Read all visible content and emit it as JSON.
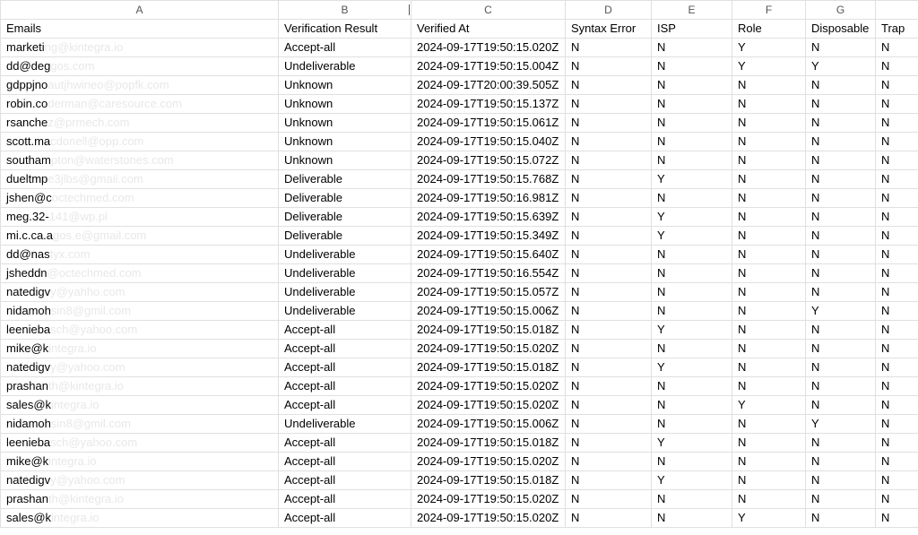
{
  "columns": [
    "A",
    "B",
    "C",
    "D",
    "E",
    "F",
    "G",
    ""
  ],
  "headers": {
    "a": "Emails",
    "b": "Verification Result",
    "c": "Verified At",
    "d": "Syntax Error",
    "e": "ISP",
    "f": "Role",
    "g": "Disposable",
    "h": "Trap"
  },
  "rows": [
    {
      "email_vis": "marketi",
      "email_rest": "ng@kintegra.io",
      "result": "Accept-all",
      "verified": "2024-09-17T19:50:15.020Z",
      "syntax": "N",
      "isp": "N",
      "role": "Y",
      "disposable": "N",
      "trap": "N"
    },
    {
      "email_vis": "dd@deg",
      "email_rest": "gos.com",
      "result": "Undeliverable",
      "verified": "2024-09-17T19:50:15.004Z",
      "syntax": "N",
      "isp": "N",
      "role": "Y",
      "disposable": "Y",
      "trap": "N"
    },
    {
      "email_vis": "gdppjno",
      "email_rest": "autjhwineo@popfk.com",
      "result": "Unknown",
      "verified": "2024-09-17T20:00:39.505Z",
      "syntax": "N",
      "isp": "N",
      "role": "N",
      "disposable": "N",
      "trap": "N"
    },
    {
      "email_vis": "robin.co",
      "email_rest": "derman@caresource.com",
      "result": "Unknown",
      "verified": "2024-09-17T19:50:15.137Z",
      "syntax": "N",
      "isp": "N",
      "role": "N",
      "disposable": "N",
      "trap": "N"
    },
    {
      "email_vis": "rsanche",
      "email_rest": "z@prmech.com",
      "result": "Unknown",
      "verified": "2024-09-17T19:50:15.061Z",
      "syntax": "N",
      "isp": "N",
      "role": "N",
      "disposable": "N",
      "trap": "N"
    },
    {
      "email_vis": "scott.ma",
      "email_rest": "cdonell@opp.com",
      "result": "Unknown",
      "verified": "2024-09-17T19:50:15.040Z",
      "syntax": "N",
      "isp": "N",
      "role": "N",
      "disposable": "N",
      "trap": "N"
    },
    {
      "email_vis": "southam",
      "email_rest": "pton@waterstones.com",
      "result": "Unknown",
      "verified": "2024-09-17T19:50:15.072Z",
      "syntax": "N",
      "isp": "N",
      "role": "N",
      "disposable": "N",
      "trap": "N"
    },
    {
      "email_vis": "dueltmp",
      "email_rest": "e3jlbs@gmail.com",
      "result": "Deliverable",
      "verified": "2024-09-17T19:50:15.768Z",
      "syntax": "N",
      "isp": "Y",
      "role": "N",
      "disposable": "N",
      "trap": "N"
    },
    {
      "email_vis": "jshen@c",
      "email_rest": "octechmed.com",
      "result": "Deliverable",
      "verified": "2024-09-17T19:50:16.981Z",
      "syntax": "N",
      "isp": "N",
      "role": "N",
      "disposable": "N",
      "trap": "N"
    },
    {
      "email_vis": "meg.32-",
      "email_rest": "141@wp.pl",
      "result": "Deliverable",
      "verified": "2024-09-17T19:50:15.639Z",
      "syntax": "N",
      "isp": "Y",
      "role": "N",
      "disposable": "N",
      "trap": "N"
    },
    {
      "email_vis": "mi.c.ca.a",
      "email_rest": "gos.e@gmail.com",
      "result": "Deliverable",
      "verified": "2024-09-17T19:50:15.349Z",
      "syntax": "N",
      "isp": "Y",
      "role": "N",
      "disposable": "N",
      "trap": "N"
    },
    {
      "email_vis": "dd@nas",
      "email_rest": "tyx.com",
      "result": "Undeliverable",
      "verified": "2024-09-17T19:50:15.640Z",
      "syntax": "N",
      "isp": "N",
      "role": "N",
      "disposable": "N",
      "trap": "N"
    },
    {
      "email_vis": "jsheddn",
      "email_rest": "@octechmed.com",
      "result": "Undeliverable",
      "verified": "2024-09-17T19:50:16.554Z",
      "syntax": "N",
      "isp": "N",
      "role": "N",
      "disposable": "N",
      "trap": "N"
    },
    {
      "email_vis": "natedigv",
      "email_rest": "y@yahho.com",
      "result": "Undeliverable",
      "verified": "2024-09-17T19:50:15.057Z",
      "syntax": "N",
      "isp": "N",
      "role": "N",
      "disposable": "N",
      "trap": "N"
    },
    {
      "email_vis": "nidamoh",
      "email_rest": "sin8@gmil.com",
      "result": "Undeliverable",
      "verified": "2024-09-17T19:50:15.006Z",
      "syntax": "N",
      "isp": "N",
      "role": "N",
      "disposable": "Y",
      "trap": "N"
    },
    {
      "email_vis": "leenieba",
      "email_rest": "sch@yahoo.com",
      "result": "Accept-all",
      "verified": "2024-09-17T19:50:15.018Z",
      "syntax": "N",
      "isp": "Y",
      "role": "N",
      "disposable": "N",
      "trap": "N"
    },
    {
      "email_vis": "mike@k",
      "email_rest": "integra.io",
      "result": "Accept-all",
      "verified": "2024-09-17T19:50:15.020Z",
      "syntax": "N",
      "isp": "N",
      "role": "N",
      "disposable": "N",
      "trap": "N"
    },
    {
      "email_vis": "natedigv",
      "email_rest": "y@yahoo.com",
      "result": "Accept-all",
      "verified": "2024-09-17T19:50:15.018Z",
      "syntax": "N",
      "isp": "Y",
      "role": "N",
      "disposable": "N",
      "trap": "N"
    },
    {
      "email_vis": "prashan",
      "email_rest": "th@kintegra.io",
      "result": "Accept-all",
      "verified": "2024-09-17T19:50:15.020Z",
      "syntax": "N",
      "isp": "N",
      "role": "N",
      "disposable": "N",
      "trap": "N"
    },
    {
      "email_vis": "sales@k",
      "email_rest": "integra.io",
      "result": "Accept-all",
      "verified": "2024-09-17T19:50:15.020Z",
      "syntax": "N",
      "isp": "N",
      "role": "Y",
      "disposable": "N",
      "trap": "N"
    },
    {
      "email_vis": "nidamoh",
      "email_rest": "sin8@gmil.com",
      "result": "Undeliverable",
      "verified": "2024-09-17T19:50:15.006Z",
      "syntax": "N",
      "isp": "N",
      "role": "N",
      "disposable": "Y",
      "trap": "N"
    },
    {
      "email_vis": "leenieba",
      "email_rest": "sch@yahoo.com",
      "result": "Accept-all",
      "verified": "2024-09-17T19:50:15.018Z",
      "syntax": "N",
      "isp": "Y",
      "role": "N",
      "disposable": "N",
      "trap": "N"
    },
    {
      "email_vis": "mike@k",
      "email_rest": "integra.io",
      "result": "Accept-all",
      "verified": "2024-09-17T19:50:15.020Z",
      "syntax": "N",
      "isp": "N",
      "role": "N",
      "disposable": "N",
      "trap": "N"
    },
    {
      "email_vis": "natedigv",
      "email_rest": "y@yahoo.com",
      "result": "Accept-all",
      "verified": "2024-09-17T19:50:15.018Z",
      "syntax": "N",
      "isp": "Y",
      "role": "N",
      "disposable": "N",
      "trap": "N"
    },
    {
      "email_vis": "prashan",
      "email_rest": "th@kintegra.io",
      "result": "Accept-all",
      "verified": "2024-09-17T19:50:15.020Z",
      "syntax": "N",
      "isp": "N",
      "role": "N",
      "disposable": "N",
      "trap": "N"
    },
    {
      "email_vis": "sales@k",
      "email_rest": "integra.io",
      "result": "Accept-all",
      "verified": "2024-09-17T19:50:15.020Z",
      "syntax": "N",
      "isp": "N",
      "role": "Y",
      "disposable": "N",
      "trap": "N"
    }
  ]
}
